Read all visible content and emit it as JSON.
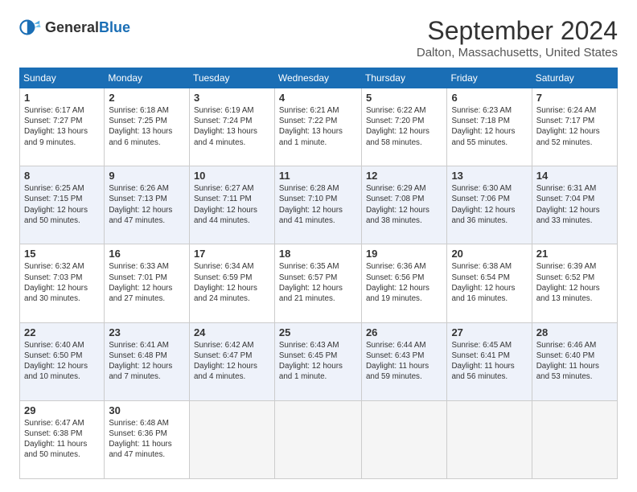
{
  "header": {
    "logo_general": "General",
    "logo_blue": "Blue",
    "month": "September 2024",
    "location": "Dalton, Massachusetts, United States"
  },
  "weekdays": [
    "Sunday",
    "Monday",
    "Tuesday",
    "Wednesday",
    "Thursday",
    "Friday",
    "Saturday"
  ],
  "weeks": [
    [
      {
        "day": "1",
        "sunrise": "Sunrise: 6:17 AM",
        "sunset": "Sunset: 7:27 PM",
        "daylight": "Daylight: 13 hours and 9 minutes."
      },
      {
        "day": "2",
        "sunrise": "Sunrise: 6:18 AM",
        "sunset": "Sunset: 7:25 PM",
        "daylight": "Daylight: 13 hours and 6 minutes."
      },
      {
        "day": "3",
        "sunrise": "Sunrise: 6:19 AM",
        "sunset": "Sunset: 7:24 PM",
        "daylight": "Daylight: 13 hours and 4 minutes."
      },
      {
        "day": "4",
        "sunrise": "Sunrise: 6:21 AM",
        "sunset": "Sunset: 7:22 PM",
        "daylight": "Daylight: 13 hours and 1 minute."
      },
      {
        "day": "5",
        "sunrise": "Sunrise: 6:22 AM",
        "sunset": "Sunset: 7:20 PM",
        "daylight": "Daylight: 12 hours and 58 minutes."
      },
      {
        "day": "6",
        "sunrise": "Sunrise: 6:23 AM",
        "sunset": "Sunset: 7:18 PM",
        "daylight": "Daylight: 12 hours and 55 minutes."
      },
      {
        "day": "7",
        "sunrise": "Sunrise: 6:24 AM",
        "sunset": "Sunset: 7:17 PM",
        "daylight": "Daylight: 12 hours and 52 minutes."
      }
    ],
    [
      {
        "day": "8",
        "sunrise": "Sunrise: 6:25 AM",
        "sunset": "Sunset: 7:15 PM",
        "daylight": "Daylight: 12 hours and 50 minutes."
      },
      {
        "day": "9",
        "sunrise": "Sunrise: 6:26 AM",
        "sunset": "Sunset: 7:13 PM",
        "daylight": "Daylight: 12 hours and 47 minutes."
      },
      {
        "day": "10",
        "sunrise": "Sunrise: 6:27 AM",
        "sunset": "Sunset: 7:11 PM",
        "daylight": "Daylight: 12 hours and 44 minutes."
      },
      {
        "day": "11",
        "sunrise": "Sunrise: 6:28 AM",
        "sunset": "Sunset: 7:10 PM",
        "daylight": "Daylight: 12 hours and 41 minutes."
      },
      {
        "day": "12",
        "sunrise": "Sunrise: 6:29 AM",
        "sunset": "Sunset: 7:08 PM",
        "daylight": "Daylight: 12 hours and 38 minutes."
      },
      {
        "day": "13",
        "sunrise": "Sunrise: 6:30 AM",
        "sunset": "Sunset: 7:06 PM",
        "daylight": "Daylight: 12 hours and 36 minutes."
      },
      {
        "day": "14",
        "sunrise": "Sunrise: 6:31 AM",
        "sunset": "Sunset: 7:04 PM",
        "daylight": "Daylight: 12 hours and 33 minutes."
      }
    ],
    [
      {
        "day": "15",
        "sunrise": "Sunrise: 6:32 AM",
        "sunset": "Sunset: 7:03 PM",
        "daylight": "Daylight: 12 hours and 30 minutes."
      },
      {
        "day": "16",
        "sunrise": "Sunrise: 6:33 AM",
        "sunset": "Sunset: 7:01 PM",
        "daylight": "Daylight: 12 hours and 27 minutes."
      },
      {
        "day": "17",
        "sunrise": "Sunrise: 6:34 AM",
        "sunset": "Sunset: 6:59 PM",
        "daylight": "Daylight: 12 hours and 24 minutes."
      },
      {
        "day": "18",
        "sunrise": "Sunrise: 6:35 AM",
        "sunset": "Sunset: 6:57 PM",
        "daylight": "Daylight: 12 hours and 21 minutes."
      },
      {
        "day": "19",
        "sunrise": "Sunrise: 6:36 AM",
        "sunset": "Sunset: 6:56 PM",
        "daylight": "Daylight: 12 hours and 19 minutes."
      },
      {
        "day": "20",
        "sunrise": "Sunrise: 6:38 AM",
        "sunset": "Sunset: 6:54 PM",
        "daylight": "Daylight: 12 hours and 16 minutes."
      },
      {
        "day": "21",
        "sunrise": "Sunrise: 6:39 AM",
        "sunset": "Sunset: 6:52 PM",
        "daylight": "Daylight: 12 hours and 13 minutes."
      }
    ],
    [
      {
        "day": "22",
        "sunrise": "Sunrise: 6:40 AM",
        "sunset": "Sunset: 6:50 PM",
        "daylight": "Daylight: 12 hours and 10 minutes."
      },
      {
        "day": "23",
        "sunrise": "Sunrise: 6:41 AM",
        "sunset": "Sunset: 6:48 PM",
        "daylight": "Daylight: 12 hours and 7 minutes."
      },
      {
        "day": "24",
        "sunrise": "Sunrise: 6:42 AM",
        "sunset": "Sunset: 6:47 PM",
        "daylight": "Daylight: 12 hours and 4 minutes."
      },
      {
        "day": "25",
        "sunrise": "Sunrise: 6:43 AM",
        "sunset": "Sunset: 6:45 PM",
        "daylight": "Daylight: 12 hours and 1 minute."
      },
      {
        "day": "26",
        "sunrise": "Sunrise: 6:44 AM",
        "sunset": "Sunset: 6:43 PM",
        "daylight": "Daylight: 11 hours and 59 minutes."
      },
      {
        "day": "27",
        "sunrise": "Sunrise: 6:45 AM",
        "sunset": "Sunset: 6:41 PM",
        "daylight": "Daylight: 11 hours and 56 minutes."
      },
      {
        "day": "28",
        "sunrise": "Sunrise: 6:46 AM",
        "sunset": "Sunset: 6:40 PM",
        "daylight": "Daylight: 11 hours and 53 minutes."
      }
    ],
    [
      {
        "day": "29",
        "sunrise": "Sunrise: 6:47 AM",
        "sunset": "Sunset: 6:38 PM",
        "daylight": "Daylight: 11 hours and 50 minutes."
      },
      {
        "day": "30",
        "sunrise": "Sunrise: 6:48 AM",
        "sunset": "Sunset: 6:36 PM",
        "daylight": "Daylight: 11 hours and 47 minutes."
      },
      null,
      null,
      null,
      null,
      null
    ]
  ]
}
